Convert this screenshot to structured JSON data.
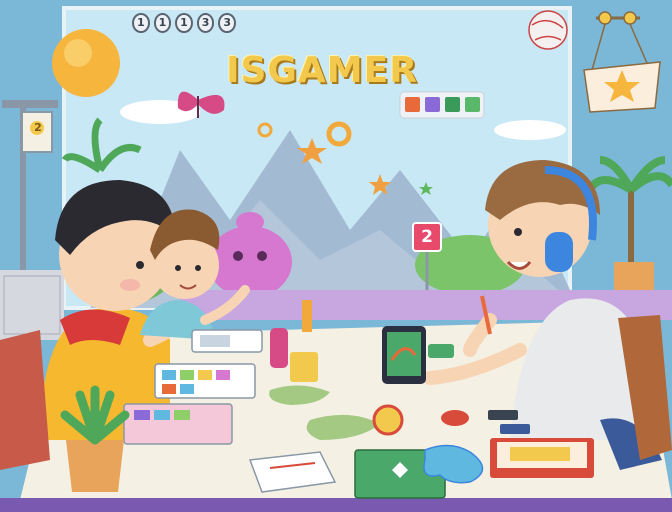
{
  "title": "ISGAMER",
  "top_dots": [
    "1",
    "1",
    "1",
    "3",
    "3"
  ],
  "sign_number": "2",
  "post_badge": "2",
  "colors": {
    "sky": "#bfe3f4",
    "wall": "#7bb7d6",
    "title_yellow": "#f2c94c",
    "table": "#f4f0e4",
    "sign_pink": "#e84a6b",
    "headphones_blue": "#3d86e0"
  },
  "icons": [
    "sun-icon",
    "butterfly-icon",
    "star-icon",
    "gear-icon",
    "lamp-icon",
    "plant-icon",
    "tablet-icon",
    "notebook-icon",
    "controller-icon",
    "headphones-icon",
    "globe-icon"
  ]
}
